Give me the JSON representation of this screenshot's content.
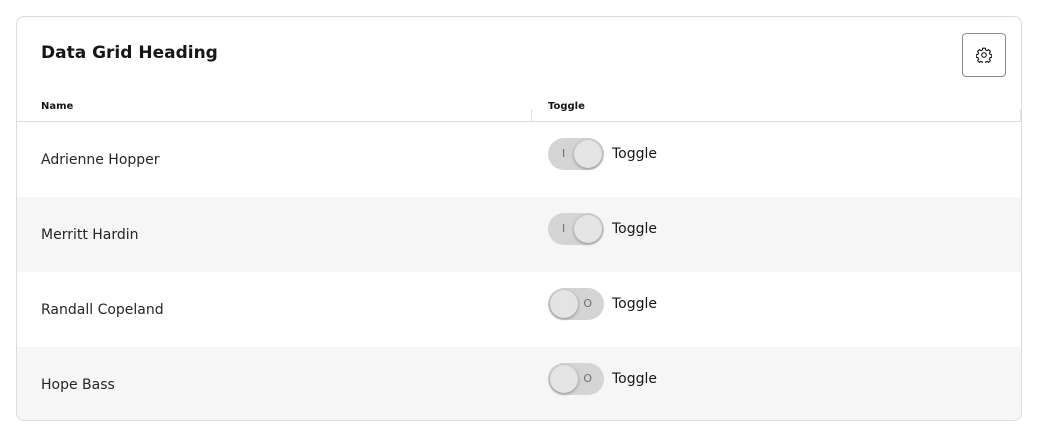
{
  "grid": {
    "heading": "Data Grid Heading",
    "settings_icon": "gear-icon",
    "columns": {
      "name": "Name",
      "toggle": "Toggle"
    },
    "rows": [
      {
        "name": "Adrienne Hopper",
        "toggle_on": true,
        "toggle_mark": "I",
        "toggle_label": "Toggle"
      },
      {
        "name": "Merritt Hardin",
        "toggle_on": true,
        "toggle_mark": "I",
        "toggle_label": "Toggle"
      },
      {
        "name": "Randall Copeland",
        "toggle_on": false,
        "toggle_mark": "O",
        "toggle_label": "Toggle"
      },
      {
        "name": "Hope Bass",
        "toggle_on": false,
        "toggle_mark": "O",
        "toggle_label": "Toggle"
      }
    ]
  }
}
